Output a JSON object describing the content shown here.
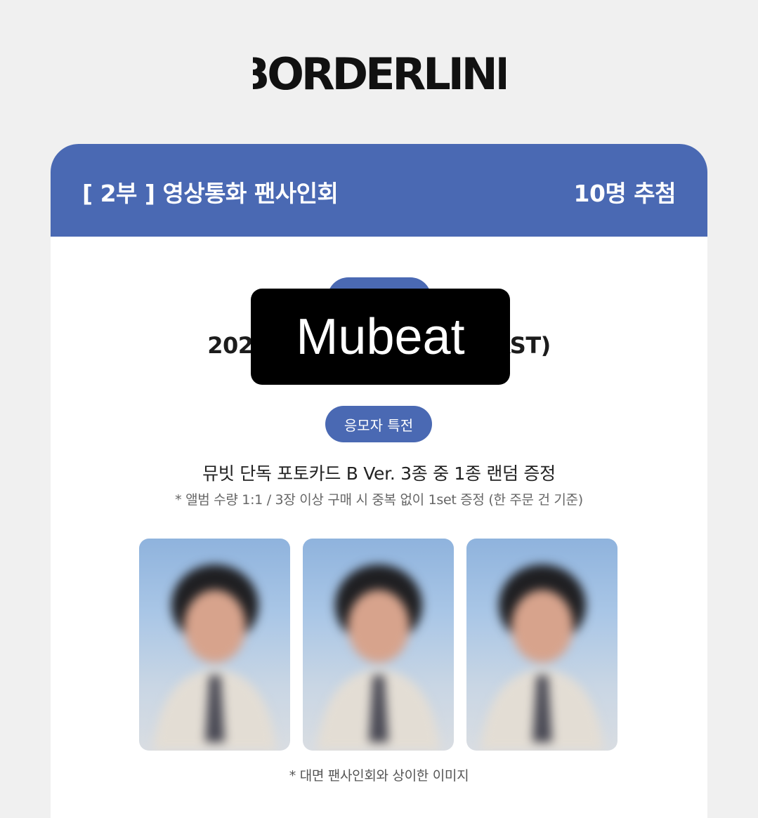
{
  "logo": {
    "text": "BORDERLINE"
  },
  "header": {
    "title": "[ 2부 ] 영상통화 팬사인회",
    "count": "10명 추첨",
    "color": "#4a69b3"
  },
  "event": {
    "date_partial": "2020                              KST)"
  },
  "watermark": {
    "text": "Mubeat"
  },
  "benefit": {
    "pill_label": "응모자 특전",
    "main": "뮤빗 단독 포토카드 B Ver. 3종 중 1종 랜덤 증정",
    "note": "* 앨범 수량 1:1 / 3장 이상 구매 시 중복 없이 1set 증정 (한 주문 건 기준)"
  },
  "photos": [
    {
      "name": "photocard-1"
    },
    {
      "name": "photocard-2"
    },
    {
      "name": "photocard-3"
    }
  ],
  "photo_caption": "* 대면 팬사인회와 상이한 이미지"
}
